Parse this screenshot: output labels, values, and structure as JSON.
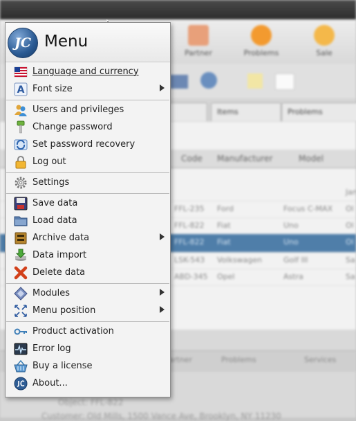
{
  "menu": {
    "title": "Menu",
    "logo_text": "JC",
    "items": [
      {
        "label": "Language and currency",
        "icon": "us-flag-icon",
        "submenu": false
      },
      {
        "label": "Font size",
        "icon": "font-size-icon",
        "submenu": true
      },
      {
        "label": "Users and privileges",
        "icon": "users-icon",
        "submenu": false
      },
      {
        "label": "Change password",
        "icon": "pin-icon",
        "submenu": false
      },
      {
        "label": "Set password recovery",
        "icon": "recovery-icon",
        "submenu": false
      },
      {
        "label": "Log out",
        "icon": "lock-icon",
        "submenu": false
      },
      {
        "label": "Settings",
        "icon": "gear-icon",
        "submenu": false
      },
      {
        "label": "Save data",
        "icon": "floppy-icon",
        "submenu": false
      },
      {
        "label": "Load data",
        "icon": "folder-icon",
        "submenu": false
      },
      {
        "label": "Archive data",
        "icon": "archive-icon",
        "submenu": true
      },
      {
        "label": "Data import",
        "icon": "import-icon",
        "submenu": false
      },
      {
        "label": "Delete data",
        "icon": "delete-x-icon",
        "submenu": false
      },
      {
        "label": "Modules",
        "icon": "modules-icon",
        "submenu": true
      },
      {
        "label": "Menu position",
        "icon": "menu-position-icon",
        "submenu": true
      },
      {
        "label": "Product activation",
        "icon": "key-icon",
        "submenu": false
      },
      {
        "label": "Error log",
        "icon": "pulse-icon",
        "submenu": false
      },
      {
        "label": "Buy a license",
        "icon": "basket-icon",
        "submenu": false
      },
      {
        "label": "About...",
        "icon": "jc-logo-icon",
        "submenu": false
      }
    ]
  },
  "background": {
    "toolbar_buttons": [
      "Partner",
      "Problems",
      "Sale"
    ],
    "tabs": [
      "Items",
      "Problems"
    ],
    "grid_headers": [
      "Code",
      "Manufacturer",
      "Model"
    ],
    "rows": [
      {
        "code": "FFL-235",
        "manufacturer": "Ford",
        "model": "Focus C-MAX",
        "status": "Ol"
      },
      {
        "code": "FFL-822",
        "manufacturer": "Fiat",
        "model": "Uno",
        "status": "Ol"
      },
      {
        "code": "FFL-822",
        "manufacturer": "Fiat",
        "model": "Uno",
        "status": "Ol"
      },
      {
        "code": "LSK-543",
        "manufacturer": "Volkswagen",
        "model": "Golf III",
        "status": "Sa"
      },
      {
        "code": "ABD-345",
        "manufacturer": "Opel",
        "model": "Astra",
        "status": "Sa"
      }
    ],
    "first_row_status": "Jan",
    "bottom_tabs": [
      "Partner",
      "Problems",
      "Services"
    ],
    "object_line": "Object: FFL-822",
    "customer_line": "Customer: Old Mills, 1500 Vance Ave, Brooklyn, NY 11230"
  }
}
